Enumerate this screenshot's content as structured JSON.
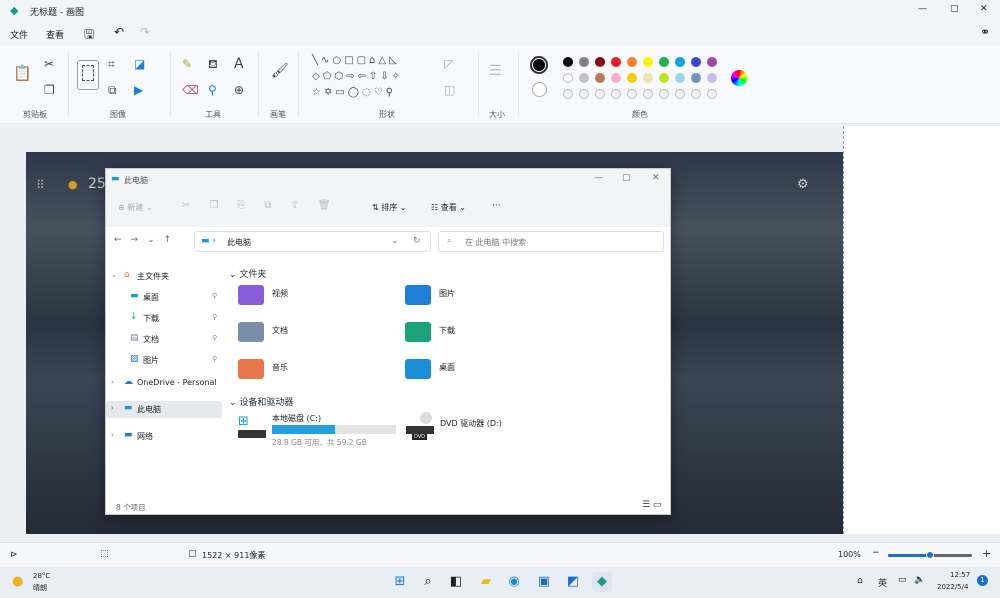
{
  "app": {
    "title": "无标题 - 画图",
    "win_controls": [
      "—",
      "▢",
      "✕"
    ]
  },
  "menu": {
    "file": "文件",
    "view": "查看"
  },
  "ribbon": {
    "groups": [
      "剪贴板",
      "图像",
      "工具",
      "画笔",
      "形状",
      "大小",
      "颜色"
    ],
    "shapes_row1": "╲∿○□▢⌂△◺",
    "shapes_row2": "◇⬠⬡⇨⇦⇧⇩✧",
    "shapes_row3": "☆✡▭◯◌♡⚲",
    "colors_row1": [
      "#000000",
      "#7f7f7f",
      "#880015",
      "#ed1c24",
      "#ff7f27",
      "#fff200",
      "#22b14c",
      "#00a2e8",
      "#3f48cc",
      "#a349a4"
    ],
    "colors_row2": [
      "#ffffff",
      "#c3c3c3",
      "#b97a57",
      "#ffaec9",
      "#ffc90e",
      "#efe4b0",
      "#b5e61d",
      "#99d9ea",
      "#7092be",
      "#c8bfe7"
    ],
    "primary": "#000000",
    "secondary": "#ffffff"
  },
  "canvas_overlay": {
    "clock_partial": "25"
  },
  "explorer": {
    "title": "此电脑",
    "toolbar": {
      "new": "新建",
      "sort": "排序",
      "view": "查看",
      "more": "···"
    },
    "address": "此电脑",
    "search_placeholder": "在 此电脑 中搜索",
    "nav": [
      {
        "label": "主文件夹",
        "icon": "home-icon"
      },
      {
        "label": "桌面",
        "icon": "desktop-icon"
      },
      {
        "label": "下载",
        "icon": "download-icon"
      },
      {
        "label": "文档",
        "icon": "document-icon"
      },
      {
        "label": "图片",
        "icon": "picture-icon"
      },
      {
        "label": "OneDrive - Personal",
        "icon": "cloud-icon"
      },
      {
        "label": "此电脑",
        "icon": "computer-icon"
      },
      {
        "label": "网络",
        "icon": "network-icon"
      }
    ],
    "folders_heading": "文件夹",
    "folders": [
      {
        "name": "视频",
        "color": "#8a5cd6"
      },
      {
        "name": "图片",
        "color": "#1e7fd6"
      },
      {
        "name": "文档",
        "color": "#7a8ea8"
      },
      {
        "name": "下载",
        "color": "#1aa37a"
      },
      {
        "name": "音乐",
        "color": "#e8774e"
      },
      {
        "name": "桌面",
        "color": "#1a8ed6"
      }
    ],
    "drives_heading": "设备和驱动器",
    "drives": [
      {
        "name": "本地磁盘 (C:)",
        "free": "28.8 GB 可用，共 59.2 GB",
        "used_fraction": 0.51
      },
      {
        "name": "DVD 驱动器 (D:)",
        "badge": "DVD"
      }
    ],
    "status": "8 个项目"
  },
  "statusbar": {
    "dimensions": "1522 × 911像素",
    "zoom": "100%",
    "zoom_fraction": 0.5
  },
  "taskbar": {
    "temp": "28°C",
    "weather": "晴朗",
    "ime": "英",
    "time": "12:57",
    "date": "2022/5/4"
  }
}
